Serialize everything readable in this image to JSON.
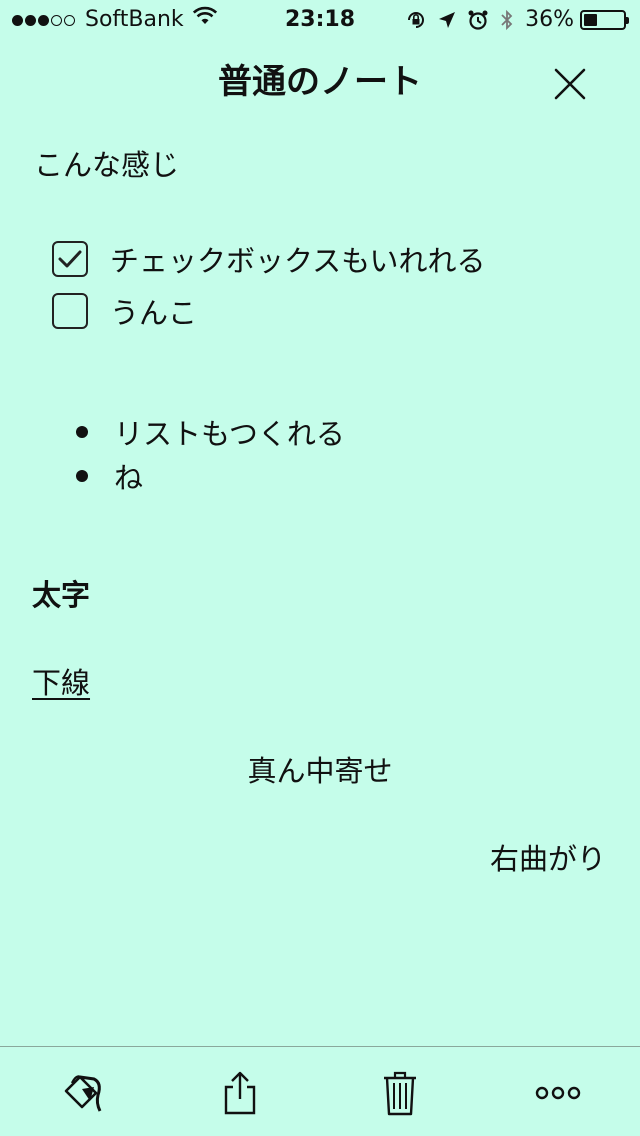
{
  "status_bar": {
    "carrier": "SoftBank",
    "time": "23:18",
    "battery": "36%",
    "battery_level": 0.36,
    "signal_bars_filled": 3,
    "signal_bars_total": 5
  },
  "note": {
    "title": "普通のノート",
    "paragraph1": "こんな感じ",
    "checklist": [
      {
        "label": "チェックボックスもいれれる",
        "checked": true
      },
      {
        "label": "うんこ",
        "checked": false
      }
    ],
    "bullet_list": [
      "リストもつくれる",
      "ね"
    ],
    "bold_text": "太字",
    "underline_text": "下線",
    "center_text": "真ん中寄せ",
    "right_text": "右曲がり"
  },
  "toolbar": {
    "icons": [
      "paint-bucket-icon",
      "share-icon",
      "trash-icon",
      "more-icon"
    ]
  },
  "colors": {
    "background": "#c5fdea",
    "text": "#111111"
  }
}
